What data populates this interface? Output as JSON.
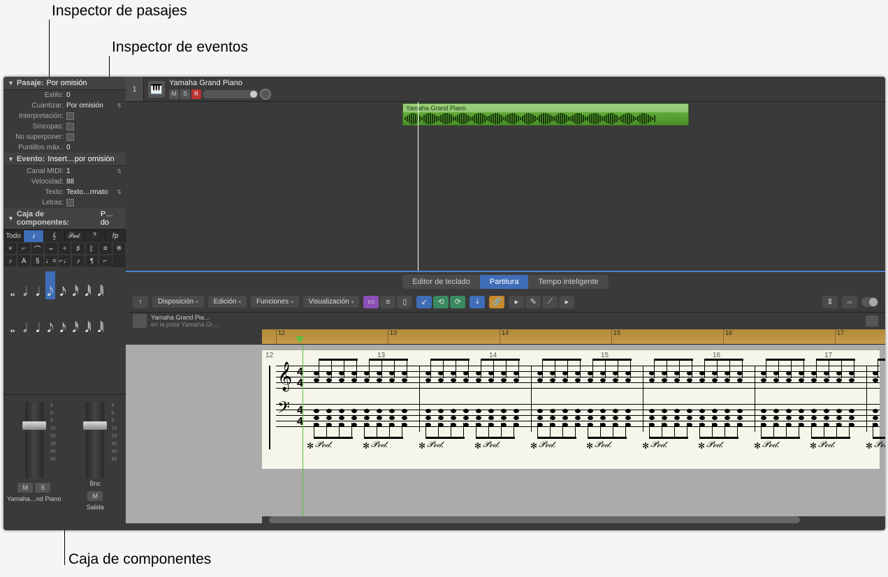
{
  "callouts": {
    "region_inspector": "Inspector de pasajes",
    "event_inspector": "Inspector de eventos",
    "part_box": "Caja de componentes"
  },
  "inspector": {
    "region": {
      "header_label": "Pasaje:",
      "header_value": "Por omisión",
      "rows": {
        "style_label": "Estilo:",
        "style_value": "0",
        "quantize_label": "Cuantizar:",
        "quantize_value": "Por omisión",
        "interpretation_label": "Interpretación:",
        "syncopation_label": "Síncopas:",
        "no_overlap_label": "No superponer:",
        "max_dots_label": "Puntillos máx.:",
        "max_dots_value": "0"
      }
    },
    "event": {
      "header_label": "Evento:",
      "header_value": "Insert…por omisión",
      "rows": {
        "midi_ch_label": "Canal MIDI:",
        "midi_ch_value": "1",
        "velocity_label": "Velocidad:",
        "velocity_value": "88",
        "text_label": "Texto:",
        "text_value": "Texto…rmato",
        "lyrics_label": "Letras:"
      }
    },
    "partbox": {
      "header_label": "Caja de componentes:",
      "header_value": "P…do",
      "tabs": [
        "Todo",
        "♪",
        "𝄞",
        "𝒫ℯ𝒹.",
        "𝄢",
        "𝑓𝑝"
      ],
      "active_tab_index": 1,
      "grid_glyphs": [
        "×",
        "⌐",
        "⌒",
        "⌣",
        "÷",
        "♯",
        "|:",
        "≡",
        "※",
        "♪",
        "A",
        "§",
        "♩=",
        "⌐♩",
        "♪",
        "¶",
        "⌐"
      ],
      "notes": [
        "𝅝",
        "𝅗𝅥",
        "𝅘𝅥",
        "𝅘𝅥𝅮",
        "𝅘𝅥𝅯",
        "𝅘𝅥𝅰",
        "𝅘𝅥𝅱",
        "𝅘𝅥𝅲"
      ],
      "selected_note_index": 3
    }
  },
  "mixer": {
    "strip1_name": "Yamaha…nd Piano",
    "strip2_name": "Salida",
    "bnc": "Bnc",
    "mute": "M",
    "solo": "S",
    "scale": [
      "6",
      "0",
      "5",
      "10",
      "20",
      "30",
      "40",
      "60"
    ]
  },
  "track": {
    "number": "1",
    "name": "Yamaha Grand Piano",
    "mute": "M",
    "solo": "S",
    "rec": "R"
  },
  "region": {
    "name": "Yamaha Grand Piano"
  },
  "editor": {
    "tabs": [
      "Editor de teclado",
      "Partitura",
      "Tempo inteligente"
    ],
    "active_tab_index": 1,
    "toolbar": {
      "back": "↑",
      "layout": "Disposición",
      "edit": "Edición",
      "functions": "Funciones",
      "view": "Visualización"
    },
    "score_track_name": "Yamaha Grand Pia…",
    "score_track_sub": "en la pista Yamaha Gr…",
    "ruler_bars": [
      "12",
      "13",
      "14",
      "15",
      "16",
      "17"
    ],
    "score_bars": [
      "12",
      "13",
      "14",
      "15",
      "16",
      "17"
    ],
    "time_sig_top": "4",
    "time_sig_bot": "4",
    "ped": "𝒫ℯ𝒹.",
    "ped_release": "✻"
  },
  "colors": {
    "accent_blue": "#3f6db8",
    "region_green": "#6fbd3f",
    "ruler_gold": "#c89a4a",
    "paper": "#f6f5ea"
  }
}
